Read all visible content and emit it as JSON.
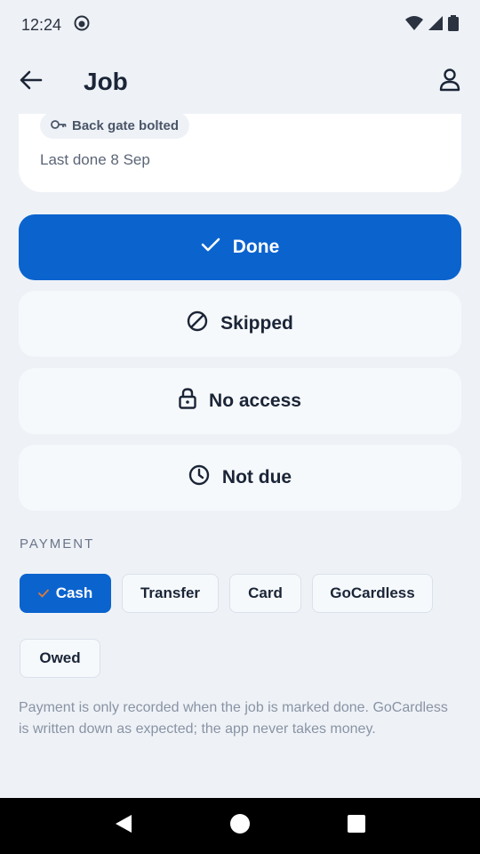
{
  "status_bar": {
    "time": "12:24"
  },
  "app_bar": {
    "title": "Job"
  },
  "job_card": {
    "note_chip": "Back gate bolted",
    "last_done": "Last done 8 Sep"
  },
  "actions": [
    {
      "label": "Done"
    },
    {
      "label": "Skipped"
    },
    {
      "label": "No access"
    },
    {
      "label": "Not due"
    }
  ],
  "payment": {
    "section_label": "PAYMENT",
    "options": [
      "Cash",
      "Transfer",
      "Card",
      "GoCardless",
      "Owed"
    ],
    "selected": "Cash",
    "note": "Payment is only recorded when the job is marked done. GoCardless is written down as expected; the app never takes money."
  },
  "colors": {
    "accent": "#0b63ce",
    "background": "#eef2f7",
    "surface": "#f6f9fc"
  }
}
